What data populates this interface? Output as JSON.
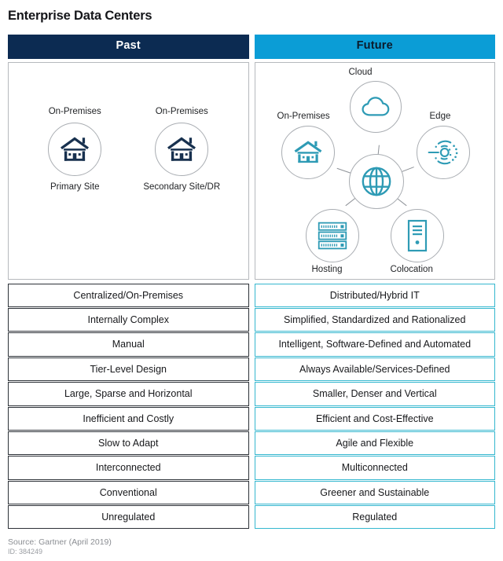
{
  "title": "Enterprise Data Centers",
  "colors": {
    "past_header_bg": "#0c2b52",
    "future_header_bg": "#0b9dd6",
    "past_icon": "#18314f",
    "future_icon": "#2e9bb5",
    "past_cell_border": "#2c3137",
    "future_cell_border": "#35b7cf"
  },
  "columns": {
    "past_label": "Past",
    "future_label": "Future"
  },
  "past_diagram": {
    "nodes": [
      {
        "top_label": "On-Premises",
        "bottom_label": "Primary Site",
        "icon": "building-icon"
      },
      {
        "top_label": "On-Premises",
        "bottom_label": "Secondary Site/DR",
        "icon": "building-icon"
      }
    ]
  },
  "future_diagram": {
    "center": {
      "label": "",
      "icon": "globe-icon"
    },
    "nodes": [
      {
        "label": "Cloud",
        "icon": "cloud-icon"
      },
      {
        "label": "On-Premises",
        "icon": "building-icon"
      },
      {
        "label": "Edge",
        "icon": "edge-network-icon"
      },
      {
        "label": "Hosting",
        "icon": "server-rack-icon"
      },
      {
        "label": "Colocation",
        "icon": "server-tower-icon"
      }
    ]
  },
  "comparison_rows": [
    {
      "past": "Centralized/On-Premises",
      "future": "Distributed/Hybrid IT"
    },
    {
      "past": "Internally Complex",
      "future": "Simplified, Standardized and Rationalized"
    },
    {
      "past": "Manual",
      "future": "Intelligent, Software-Defined and Automated"
    },
    {
      "past": "Tier-Level Design",
      "future": "Always Available/Services-Defined"
    },
    {
      "past": "Large, Sparse and Horizontal",
      "future": "Smaller, Denser and Vertical"
    },
    {
      "past": "Inefficient and Costly",
      "future": "Efficient and Cost-Effective"
    },
    {
      "past": "Slow to Adapt",
      "future": "Agile and Flexible"
    },
    {
      "past": "Interconnected",
      "future": "Multiconnected"
    },
    {
      "past": "Conventional",
      "future": "Greener and Sustainable"
    },
    {
      "past": "Unregulated",
      "future": "Regulated"
    }
  ],
  "footer": {
    "source": "Source: Gartner (April 2019)",
    "id": "ID: 384249"
  }
}
